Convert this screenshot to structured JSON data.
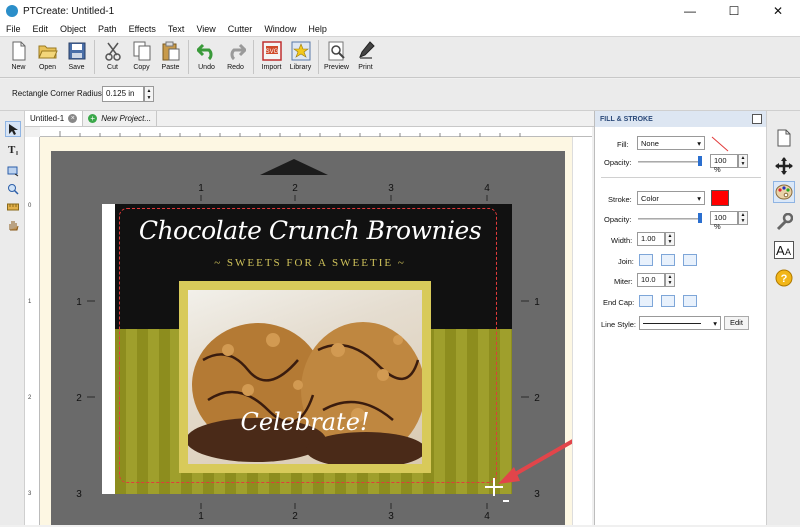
{
  "window": {
    "title": "PTCreate: Untitled-1",
    "minimize": "—",
    "maximize": "☐",
    "close": "✕"
  },
  "menu": [
    "File",
    "Edit",
    "Object",
    "Path",
    "Effects",
    "Text",
    "View",
    "Cutter",
    "Window",
    "Help"
  ],
  "toolbar": [
    {
      "label": "New",
      "icon": "new-document-icon"
    },
    {
      "label": "Open",
      "icon": "folder-open-icon"
    },
    {
      "label": "Save",
      "icon": "save-icon"
    },
    {
      "label": "Cut",
      "icon": "scissors-icon"
    },
    {
      "label": "Copy",
      "icon": "copy-icon"
    },
    {
      "label": "Paste",
      "icon": "paste-icon"
    },
    {
      "label": "Undo",
      "icon": "undo-icon"
    },
    {
      "label": "Redo",
      "icon": "redo-icon"
    },
    {
      "label": "Import",
      "icon": "import-svg-icon"
    },
    {
      "label": "Library",
      "icon": "library-star-icon"
    },
    {
      "label": "Preview",
      "icon": "magnifier-preview-icon"
    },
    {
      "label": "Print",
      "icon": "print-pen-icon"
    }
  ],
  "options": {
    "corner_radius_label": "Rectangle Corner Radius:",
    "corner_radius_value": "0.125 in"
  },
  "tabs": [
    {
      "label": "Untitled-1",
      "active": true
    },
    {
      "label": "New Project...",
      "active": false
    }
  ],
  "ruler": {
    "top_ticks": [
      "1",
      "2",
      "3",
      "4"
    ],
    "left_ticks": [
      "0",
      "1",
      "2",
      "3"
    ],
    "mat_top": [
      "1",
      "2",
      "3",
      "4"
    ],
    "mat_side": [
      "1",
      "2",
      "3"
    ]
  },
  "design": {
    "title": "Chocolate Crunch Brownies",
    "subtitle": "~ SWEETS FOR A SWEETIE ~",
    "photo_caption": "Celebrate!"
  },
  "panel": {
    "header": "FILL & STROKE",
    "fill_label": "Fill:",
    "fill_value": "None",
    "fill_opacity_label": "Opacity:",
    "fill_opacity_value": "100 %",
    "stroke_label": "Stroke:",
    "stroke_value": "Color",
    "stroke_opacity_label": "Opacity:",
    "stroke_opacity_value": "100 %",
    "width_label": "Width:",
    "width_value": "1.00",
    "join_label": "Join:",
    "miter_label": "Miter:",
    "miter_value": "10.0",
    "endcap_label": "End Cap:",
    "linestyle_label": "Line Style:",
    "edit_label": "Edit",
    "fill_opacity": 1.0,
    "stroke_opacity": 1.0
  },
  "colors": {
    "stroke_swatch": "#ff0000",
    "olive": "#8d8d1e",
    "gold_frame": "#d8ca5a",
    "mat_gray": "#6a6a6a"
  },
  "right_tools": [
    "page-icon",
    "move-arrows-icon",
    "palette-icon",
    "wrench-icon",
    "text-size-icon",
    "help-icon"
  ]
}
